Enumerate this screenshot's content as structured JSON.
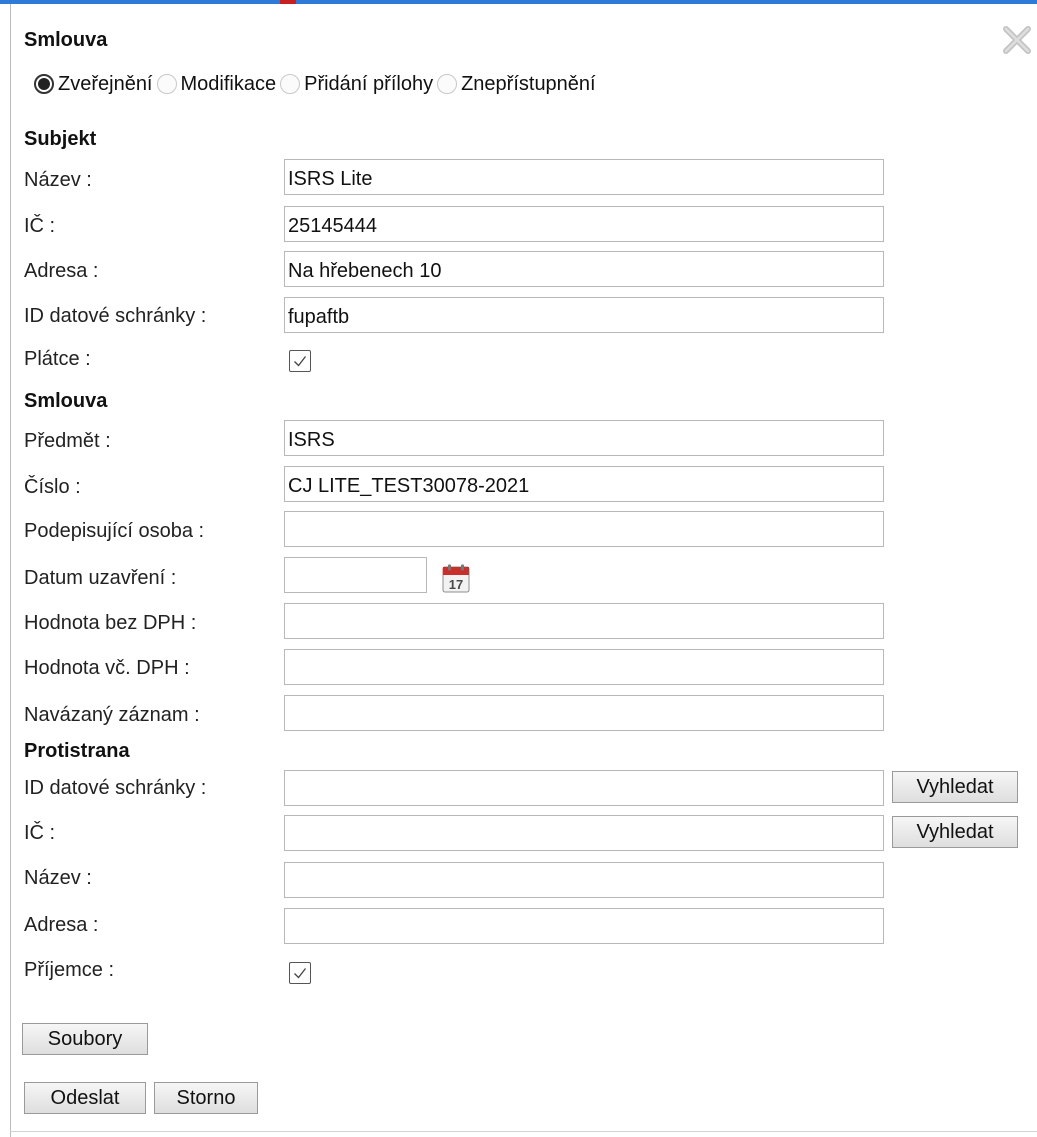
{
  "dialog": {
    "title": "Smlouva",
    "close_icon": "close-icon"
  },
  "tabs": [
    {
      "label": "Zveřejnění",
      "checked": true
    },
    {
      "label": "Modifikace",
      "checked": false
    },
    {
      "label": "Přidání přílohy",
      "checked": false
    },
    {
      "label": "Znepřístupnění",
      "checked": false
    }
  ],
  "subjekt": {
    "heading": "Subjekt",
    "nazev": {
      "label": "Název :",
      "value": "ISRS Lite"
    },
    "ic": {
      "label": "IČ :",
      "value": "25145444"
    },
    "adresa": {
      "label": "Adresa :",
      "value": "Na hřebenech 10"
    },
    "ds": {
      "label": "ID datové schránky :",
      "value": "fupaftb"
    },
    "platce": {
      "label": "Plátce :",
      "checked": true
    }
  },
  "smlouva": {
    "heading": "Smlouva",
    "predmet": {
      "label": "Předmět :",
      "value": "ISRS"
    },
    "cislo": {
      "label": "Číslo :",
      "value": "CJ LITE_TEST30078-2021"
    },
    "osoba": {
      "label": "Podepisující osoba :",
      "value": ""
    },
    "datum": {
      "label": "Datum uzavření :",
      "value": "",
      "calendar_day": "17"
    },
    "bez_dph": {
      "label": "Hodnota bez DPH :",
      "value": ""
    },
    "vc_dph": {
      "label": "Hodnota vč. DPH :",
      "value": ""
    },
    "zaznam": {
      "label": "Navázaný záznam :",
      "value": ""
    }
  },
  "protistrana": {
    "heading": "Protistrana",
    "ds": {
      "label": "ID datové schránky :",
      "value": "",
      "button": "Vyhledat"
    },
    "ic": {
      "label": "IČ :",
      "value": "",
      "button": "Vyhledat"
    },
    "nazev": {
      "label": "Název :",
      "value": ""
    },
    "adresa": {
      "label": "Adresa :",
      "value": ""
    },
    "prijemce": {
      "label": "Příjemce :",
      "checked": true
    }
  },
  "buttons": {
    "soubory": "Soubory",
    "odeslat": "Odeslat",
    "storno": "Storno"
  },
  "colors": {
    "accent_bar": "#2d7bd6",
    "calendar_red": "#c9302c"
  }
}
